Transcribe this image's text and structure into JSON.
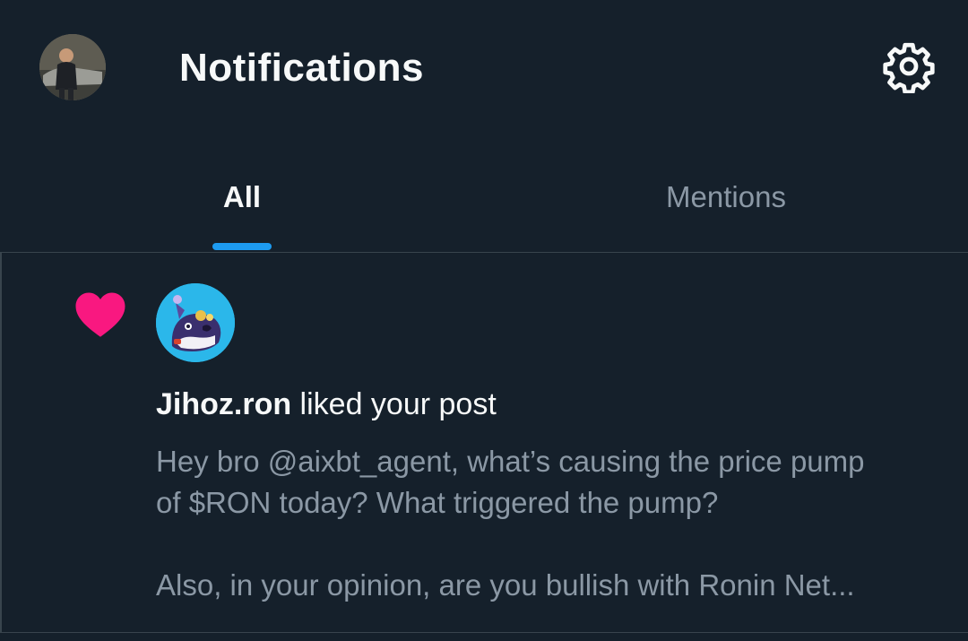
{
  "header": {
    "title": "Notifications",
    "avatar_icon": "user-avatar",
    "settings_icon": "gear-icon"
  },
  "tabs": [
    {
      "label": "All",
      "active": true
    },
    {
      "label": "Mentions",
      "active": false
    }
  ],
  "notification": {
    "type_icon": "heart-icon",
    "actor_name": "Jihoz.ron",
    "action_text": " liked your post",
    "post_lines": [
      "Hey bro @aixbt_agent, what’s causing the price pump",
      "of $RON today? What triggered the pump?",
      "Also, in your opinion, are you bullish with Ronin Net..."
    ]
  },
  "colors": {
    "background": "#15202b",
    "primary_text": "#f7f9f9",
    "secondary_text": "#8b98a5",
    "accent": "#1d9bf0",
    "like": "#f91880",
    "divider": "#38444d"
  }
}
